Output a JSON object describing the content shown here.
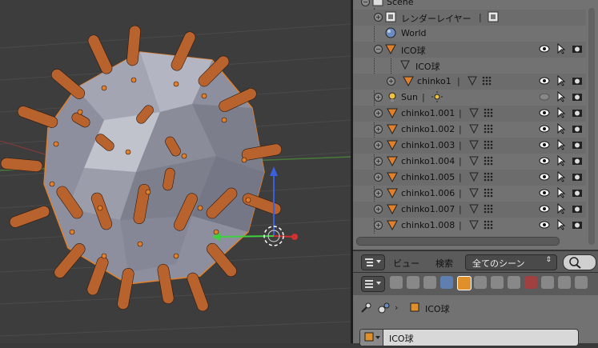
{
  "outliner": {
    "rows": [
      {
        "label": "Scene",
        "indent": 0
      },
      {
        "label": "レンダーレイヤー",
        "indent": 1
      },
      {
        "label": "World",
        "indent": 1
      },
      {
        "label": "ICO球",
        "indent": 1
      },
      {
        "label": "ICO球",
        "indent": 2
      },
      {
        "label": "chinko1",
        "indent": 2
      },
      {
        "label": "Sun",
        "indent": 1
      },
      {
        "label": "chinko1.001",
        "indent": 1
      },
      {
        "label": "chinko1.002",
        "indent": 1
      },
      {
        "label": "chinko1.003",
        "indent": 1
      },
      {
        "label": "chinko1.004",
        "indent": 1
      },
      {
        "label": "chinko1.005",
        "indent": 1
      },
      {
        "label": "chinko1.006",
        "indent": 1
      },
      {
        "label": "chinko1.007",
        "indent": 1
      },
      {
        "label": "chinko1.008",
        "indent": 1
      }
    ]
  },
  "header": {
    "view_menu": "ビュー",
    "search_menu": "検索",
    "display_mode": "全てのシーン"
  },
  "properties": {
    "breadcrumb_object": "ICO球",
    "object_name": "ICO球"
  },
  "colors": {
    "object_orange": "#e0802a",
    "viewport_bg": "#3d3d3d",
    "panel_bg": "#727272"
  }
}
